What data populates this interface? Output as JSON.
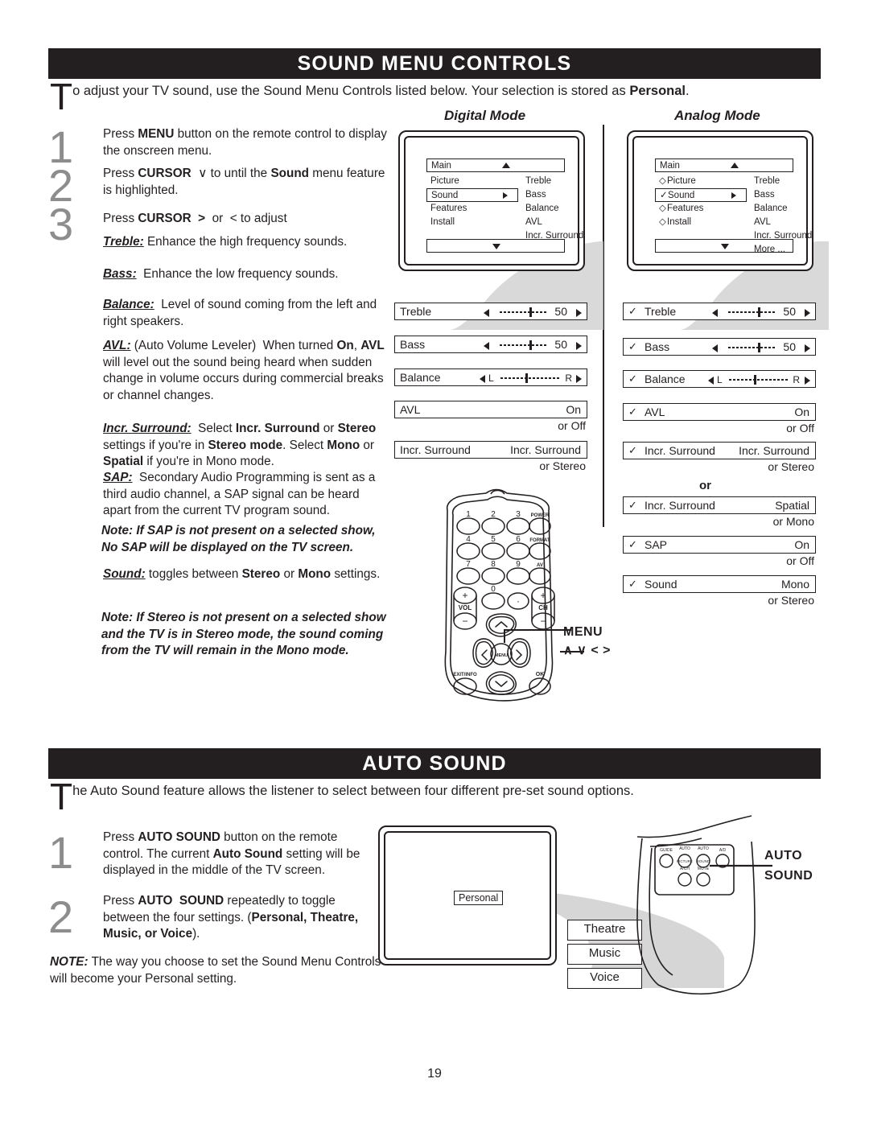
{
  "page": {
    "number": "19"
  },
  "sections": {
    "sound_menu": {
      "banner": "SOUND MENU CONTROLS",
      "intro_dropcap": "T",
      "intro_rest_1": "o adjust your TV sound, use the Sound Menu Controls listed below.  Your selection is stored as ",
      "intro_bold": "Personal",
      "intro_rest_2": ".",
      "steps": [
        {
          "number": "1",
          "text_parts": [
            {
              "t": "Press ",
              "b": false
            },
            {
              "t": "MENU",
              "b": true
            },
            {
              "t": " button on the remote control to display the onscreen menu.",
              "b": false
            }
          ]
        },
        {
          "number": "2",
          "text_parts": [
            {
              "t": "Press ",
              "b": false
            },
            {
              "t": "CURSOR",
              "b": true
            },
            {
              "t": "  ∨ to until the ",
              "b": false
            },
            {
              "t": "Sound",
              "b": true
            },
            {
              "t": " menu feature is highlighted.",
              "b": false
            }
          ]
        },
        {
          "number": "3",
          "text_parts": [
            {
              "t": "Press ",
              "b": false
            },
            {
              "t": "CURSOR  >",
              "b": true
            },
            {
              "t": "  or  < to adjust",
              "b": false
            }
          ]
        }
      ],
      "definitions": [
        {
          "term": "Treble:",
          "body": " Enhance the high frequency sounds."
        },
        {
          "term": "Bass:",
          "body": "  Enhance the low frequency sounds."
        },
        {
          "term": "Balance:",
          "body": "  Level of sound coming from the left and right speakers."
        },
        {
          "term": "AVL:",
          "body": " (Auto Volume Leveler)  When turned On, AVL will level out the sound being heard when sudden change in volume occurs during commercial breaks or channel changes."
        },
        {
          "term": "Incr. Surround:",
          "body": " Select Incr. Surround or Stereo settings if you're in Stereo mode. Select Mono or Spatial if you're in Mono mode."
        },
        {
          "term": "SAP:",
          "body": " Secondary Audio Programming is sent as a third audio channel, a SAP signal can be heard apart from the current TV program sound."
        },
        {
          "term": "Sound:",
          "body": " toggles between Stereo or Mono settings."
        }
      ],
      "note_sap": "Note:  If SAP is not present on a selected show, No SAP will be displayed on the TV screen.",
      "note_stereo": "Note: If  Stereo is not present on a selected show and the TV is in Stereo mode, the sound coming from the TV will remain in the Mono mode."
    },
    "auto_sound": {
      "banner": "AUTO SOUND",
      "intro_dropcap": "T",
      "intro_rest": "he Auto Sound feature allows the listener to select between four different pre-set sound options.",
      "steps": [
        {
          "number": "1",
          "text_parts": [
            {
              "t": "Press ",
              "b": false
            },
            {
              "t": "AUTO SOUND",
              "b": true
            },
            {
              "t": " button on the remote control. The current ",
              "b": false
            },
            {
              "t": "Auto Sound",
              "b": true
            },
            {
              "t": " setting will be displayed in the middle of the TV screen.",
              "b": false
            }
          ]
        },
        {
          "number": "2",
          "text_parts": [
            {
              "t": "Press ",
              "b": false
            },
            {
              "t": "AUTO  SOUND",
              "b": true
            },
            {
              "t": " repeatedly to toggle between the four settings. (",
              "b": false
            },
            {
              "t": "Personal, Theatre, Music, or Voice",
              "b": true
            },
            {
              "t": ").",
              "b": false
            }
          ]
        }
      ],
      "note": "NOTE: The way you choose to set the Sound Menu Controls will become your Personal setting.",
      "note_lead": "NOTE:",
      "note_body": " The way you choose to set the Sound Menu Controls will become your Personal setting.",
      "screen_value": "Personal",
      "options": [
        "Theatre",
        "Music",
        "Voice"
      ],
      "remote_callout": [
        "AUTO",
        "SOUND"
      ],
      "remote_buttons_row1": [
        "GUIDE",
        "AUTO PICTURE",
        "AUTO SOUND",
        "A/D"
      ],
      "remote_buttons_row2": [
        "A/CH",
        "MUTE"
      ]
    }
  },
  "digital_mode": {
    "title": "Digital Mode",
    "osd_menu": {
      "header": "Main",
      "left_items": [
        "Picture",
        "Sound",
        "Features",
        "Install"
      ],
      "selected_left": "Sound",
      "right_items": [
        "Treble",
        "Bass",
        "Balance",
        "AVL",
        "Incr. Surround"
      ]
    },
    "settings": [
      {
        "label": "Treble",
        "type": "slider",
        "value": "50",
        "sub": ""
      },
      {
        "label": "Bass",
        "type": "slider",
        "value": "50",
        "sub": ""
      },
      {
        "label": "Balance",
        "type": "balance",
        "left": "L",
        "right": "R",
        "sub": ""
      },
      {
        "label": "AVL",
        "type": "value",
        "value": "On",
        "sub": "or Off"
      },
      {
        "label": "Incr. Surround",
        "type": "value",
        "value": "Incr. Surround",
        "sub": "or Stereo"
      }
    ]
  },
  "analog_mode": {
    "title": "Analog Mode",
    "osd_menu": {
      "header": "Main",
      "left_items": [
        "Picture",
        "Sound",
        "Features",
        "Install"
      ],
      "left_bullets": [
        "◇",
        "✓",
        "◇",
        "◇"
      ],
      "selected_left": "Sound",
      "right_items": [
        "Treble",
        "Bass",
        "Balance",
        "AVL",
        "Incr. Surround",
        "More ..."
      ]
    },
    "or_separator": "or",
    "settings": [
      {
        "check": "✓",
        "label": "Treble",
        "type": "slider",
        "value": "50",
        "sub": ""
      },
      {
        "check": "✓",
        "label": "Bass",
        "type": "slider",
        "value": "50",
        "sub": ""
      },
      {
        "check": "✓",
        "label": "Balance",
        "type": "balance",
        "left": "L",
        "right": "R",
        "sub": ""
      },
      {
        "check": "✓",
        "label": "AVL",
        "type": "value",
        "value": "On",
        "sub": "or Off"
      },
      {
        "check": "✓",
        "label": "Incr. Surround",
        "type": "value",
        "value": "Incr. Surround",
        "sub": "or Stereo"
      },
      {
        "check": "✓",
        "label": "Incr. Surround",
        "type": "value",
        "value": "Spatial",
        "sub": "or Mono"
      },
      {
        "check": "✓",
        "label": "SAP",
        "type": "value",
        "value": "On",
        "sub": "or Off"
      },
      {
        "check": "✓",
        "label": "Sound",
        "type": "value",
        "value": "Mono",
        "sub": "or Stereo"
      }
    ]
  },
  "remote": {
    "callout_line1": "MENU",
    "callout_line2": "∧  ∨  <  >",
    "keypad": [
      "1",
      "2",
      "3",
      "POWER",
      "4",
      "5",
      "6",
      "FORMAT",
      "7",
      "8",
      "9",
      "AV"
    ],
    "zero": "0",
    "dot": "·",
    "vol_label": "VOL",
    "ch_label": "CH",
    "plus": "+",
    "minus": "−",
    "menu_button": "MENU",
    "exit_button": "EXIT/INFO",
    "ok_button": "OK"
  }
}
